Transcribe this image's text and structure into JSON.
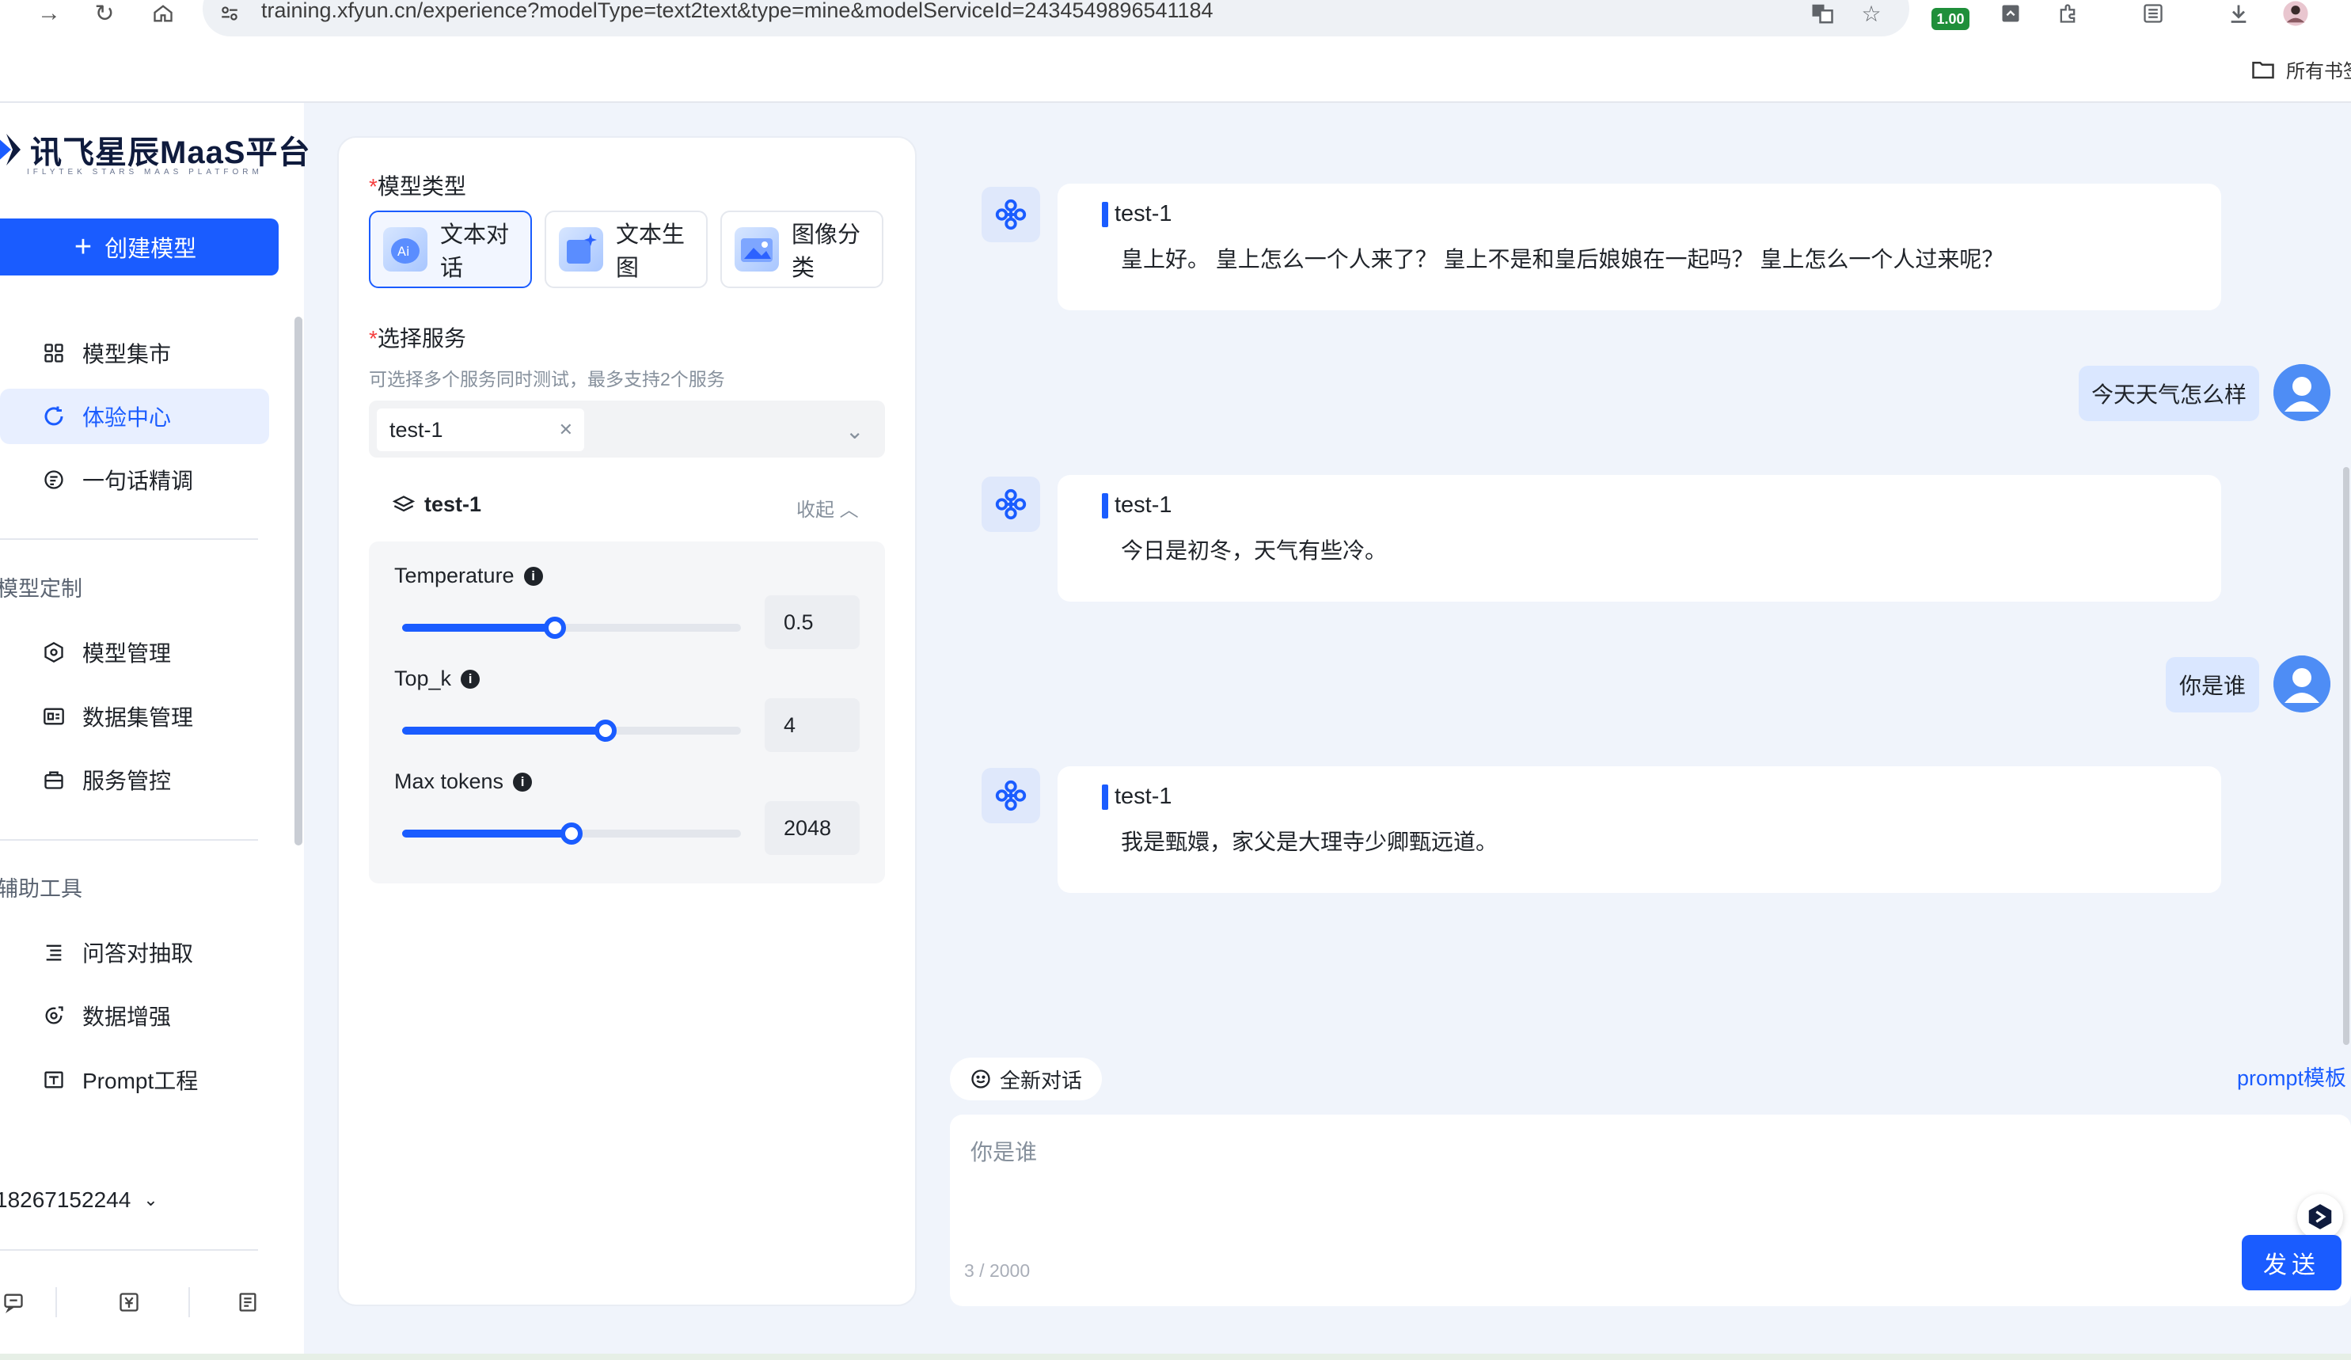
{
  "browser": {
    "url": "training.xfyun.cn/experience?modelType=text2text&type=mine&modelServiceId=2434549896541184",
    "zoom_badge": "1.00",
    "bookmarks_folder": "所有书签"
  },
  "sidebar": {
    "logo_title": "讯飞星辰MaaS平台",
    "logo_subtitle": "IFLYTEK STARS MAAS PLATFORM",
    "create_button": "创建模型",
    "nav": [
      {
        "label": "模型集市"
      },
      {
        "label": "体验中心"
      },
      {
        "label": "一句话精调"
      }
    ],
    "section_custom": "模型定制",
    "custom_items": [
      {
        "label": "模型管理"
      },
      {
        "label": "数据集管理"
      },
      {
        "label": "服务管控"
      }
    ],
    "section_tools": "辅助工具",
    "tool_items": [
      {
        "label": "问答对抽取"
      },
      {
        "label": "数据增强"
      },
      {
        "label": "Prompt工程"
      }
    ],
    "account": "18267152244"
  },
  "config": {
    "model_type_label": "模型类型",
    "model_types": [
      {
        "label": "文本对话",
        "active": true
      },
      {
        "label": "文本生图",
        "active": false
      },
      {
        "label": "图像分类",
        "active": false
      }
    ],
    "service_label": "选择服务",
    "service_hint": "可选择多个服务同时测试，最多支持2个服务",
    "selected_service": "test-1",
    "param_title": "test-1",
    "collapse_label": "收起",
    "params": [
      {
        "name": "Temperature",
        "value": "0.5",
        "fraction": 0.45
      },
      {
        "name": "Top_k",
        "value": "4",
        "fraction": 0.6
      },
      {
        "name": "Max tokens",
        "value": "2048",
        "fraction": 0.5
      }
    ]
  },
  "chat": {
    "messages": [
      {
        "role": "bot",
        "name": "test-1",
        "text": "皇上好。 皇上怎么一个人来了？ 皇上不是和皇后娘娘在一起吗？ 皇上怎么一个人过来呢？"
      },
      {
        "role": "user",
        "text": "今天天气怎么样"
      },
      {
        "role": "bot",
        "name": "test-1",
        "text": "今日是初冬，天气有些冷。"
      },
      {
        "role": "user",
        "text": "你是谁"
      },
      {
        "role": "bot",
        "name": "test-1",
        "text": "我是甄嬛，家父是大理寺少卿甄远道。"
      }
    ],
    "new_chat_label": "全新对话",
    "prompt_template_label": "prompt模板",
    "input_value": "你是谁",
    "char_count": "3 / 2000",
    "send_label": "发送"
  },
  "colors": {
    "accent": "#1a5cff",
    "page_bg": "#f0f4fb",
    "user_bubble": "#dae7ff"
  }
}
